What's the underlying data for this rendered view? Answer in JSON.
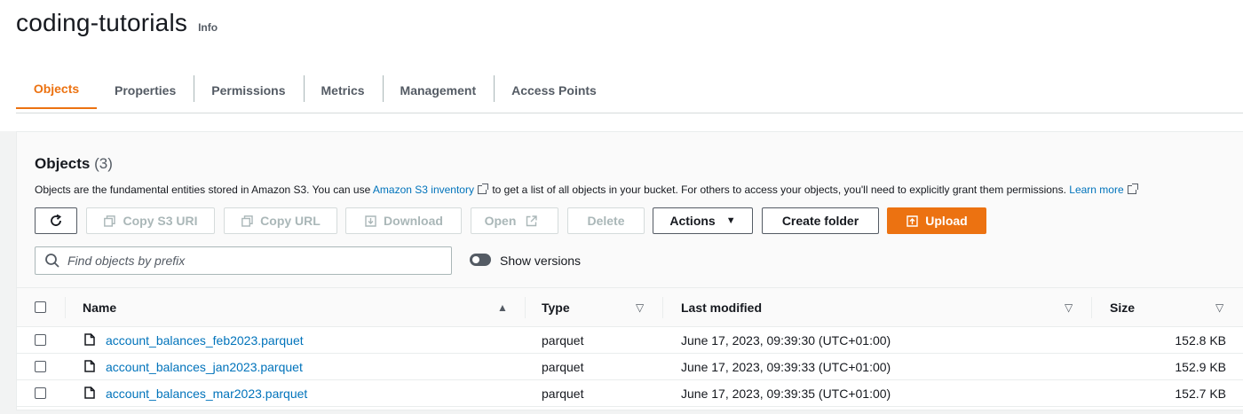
{
  "header": {
    "title": "coding-tutorials",
    "info_label": "Info"
  },
  "tabs": [
    {
      "label": "Objects",
      "active": true
    },
    {
      "label": "Properties",
      "active": false
    },
    {
      "label": "Permissions",
      "active": false
    },
    {
      "label": "Metrics",
      "active": false
    },
    {
      "label": "Management",
      "active": false
    },
    {
      "label": "Access Points",
      "active": false
    }
  ],
  "objects": {
    "title": "Objects",
    "count": "(3)",
    "description_pre": "Objects are the fundamental entities stored in Amazon S3. You can use",
    "inventory_link": "Amazon S3 inventory",
    "description_mid": "to get a list of all objects in your bucket. For others to access your objects, you'll need to explicitly grant them permissions.",
    "learn_more": "Learn more"
  },
  "toolbar": {
    "copy_s3_uri": "Copy S3 URI",
    "copy_url": "Copy URL",
    "download": "Download",
    "open": "Open",
    "delete": "Delete",
    "actions": "Actions",
    "create_folder": "Create folder",
    "upload": "Upload"
  },
  "search": {
    "placeholder": "Find objects by prefix"
  },
  "show_versions": {
    "label": "Show versions",
    "enabled": false
  },
  "table": {
    "columns": {
      "name": "Name",
      "type": "Type",
      "last_modified": "Last modified",
      "size": "Size"
    },
    "rows": [
      {
        "name": "account_balances_feb2023.parquet",
        "type": "parquet",
        "last_modified": "June 17, 2023, 09:39:30 (UTC+01:00)",
        "size": "152.8 KB"
      },
      {
        "name": "account_balances_jan2023.parquet",
        "type": "parquet",
        "last_modified": "June 17, 2023, 09:39:33 (UTC+01:00)",
        "size": "152.9 KB"
      },
      {
        "name": "account_balances_mar2023.parquet",
        "type": "parquet",
        "last_modified": "June 17, 2023, 09:39:35 (UTC+01:00)",
        "size": "152.7 KB"
      }
    ]
  },
  "colors": {
    "accent": "#ec7211",
    "link": "#0073bb",
    "text": "#16191f",
    "muted": "#545b64"
  }
}
